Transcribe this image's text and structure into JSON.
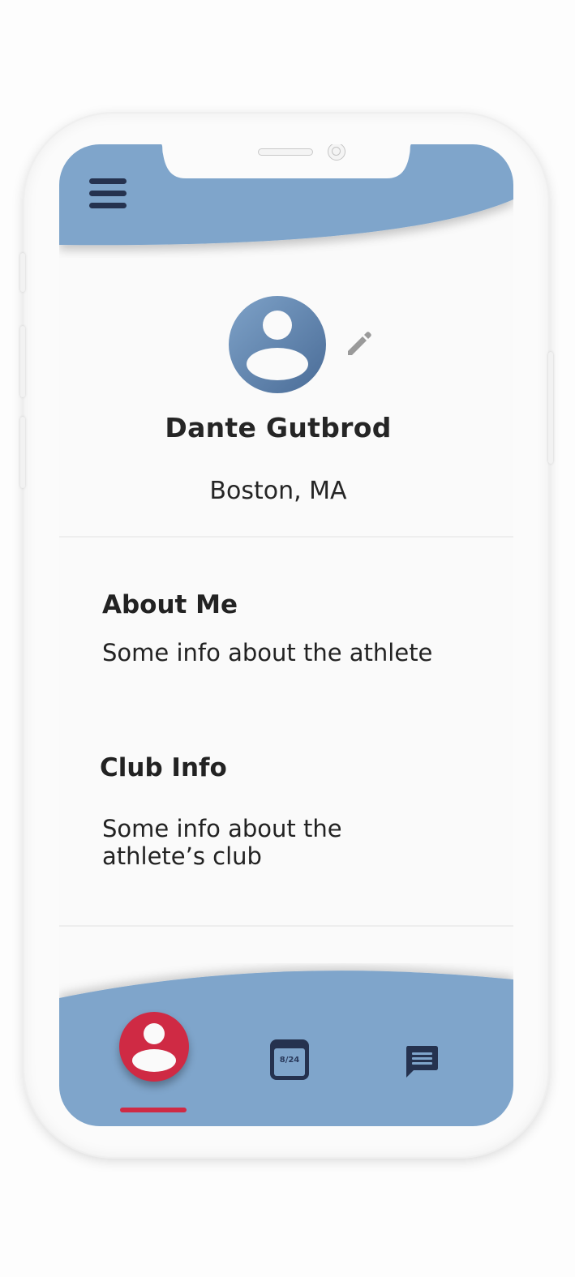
{
  "colors": {
    "accent_blue": "#7fa5cb",
    "active_red": "#cf2a44",
    "dark_navy": "#25324f",
    "avatar_gradient_start": "#7ea2c8",
    "avatar_gradient_end": "#4a6c97"
  },
  "header": {
    "menu_icon": "hamburger-menu-icon"
  },
  "profile": {
    "name": "Dante Gutbrod",
    "location": "Boston, MA",
    "avatar_icon": "account-circle-icon",
    "edit_icon": "pencil-icon"
  },
  "sections": {
    "about": {
      "title": "About Me",
      "text": "Some info about the athlete"
    },
    "club": {
      "title": "Club Info",
      "text": "Some info about the athlete’s club"
    }
  },
  "bottom_nav": {
    "items": [
      {
        "icon": "account-circle-icon",
        "active": true
      },
      {
        "icon": "calendar-icon",
        "date_label": "8/24",
        "active": false
      },
      {
        "icon": "chat-message-icon",
        "active": false
      }
    ]
  }
}
